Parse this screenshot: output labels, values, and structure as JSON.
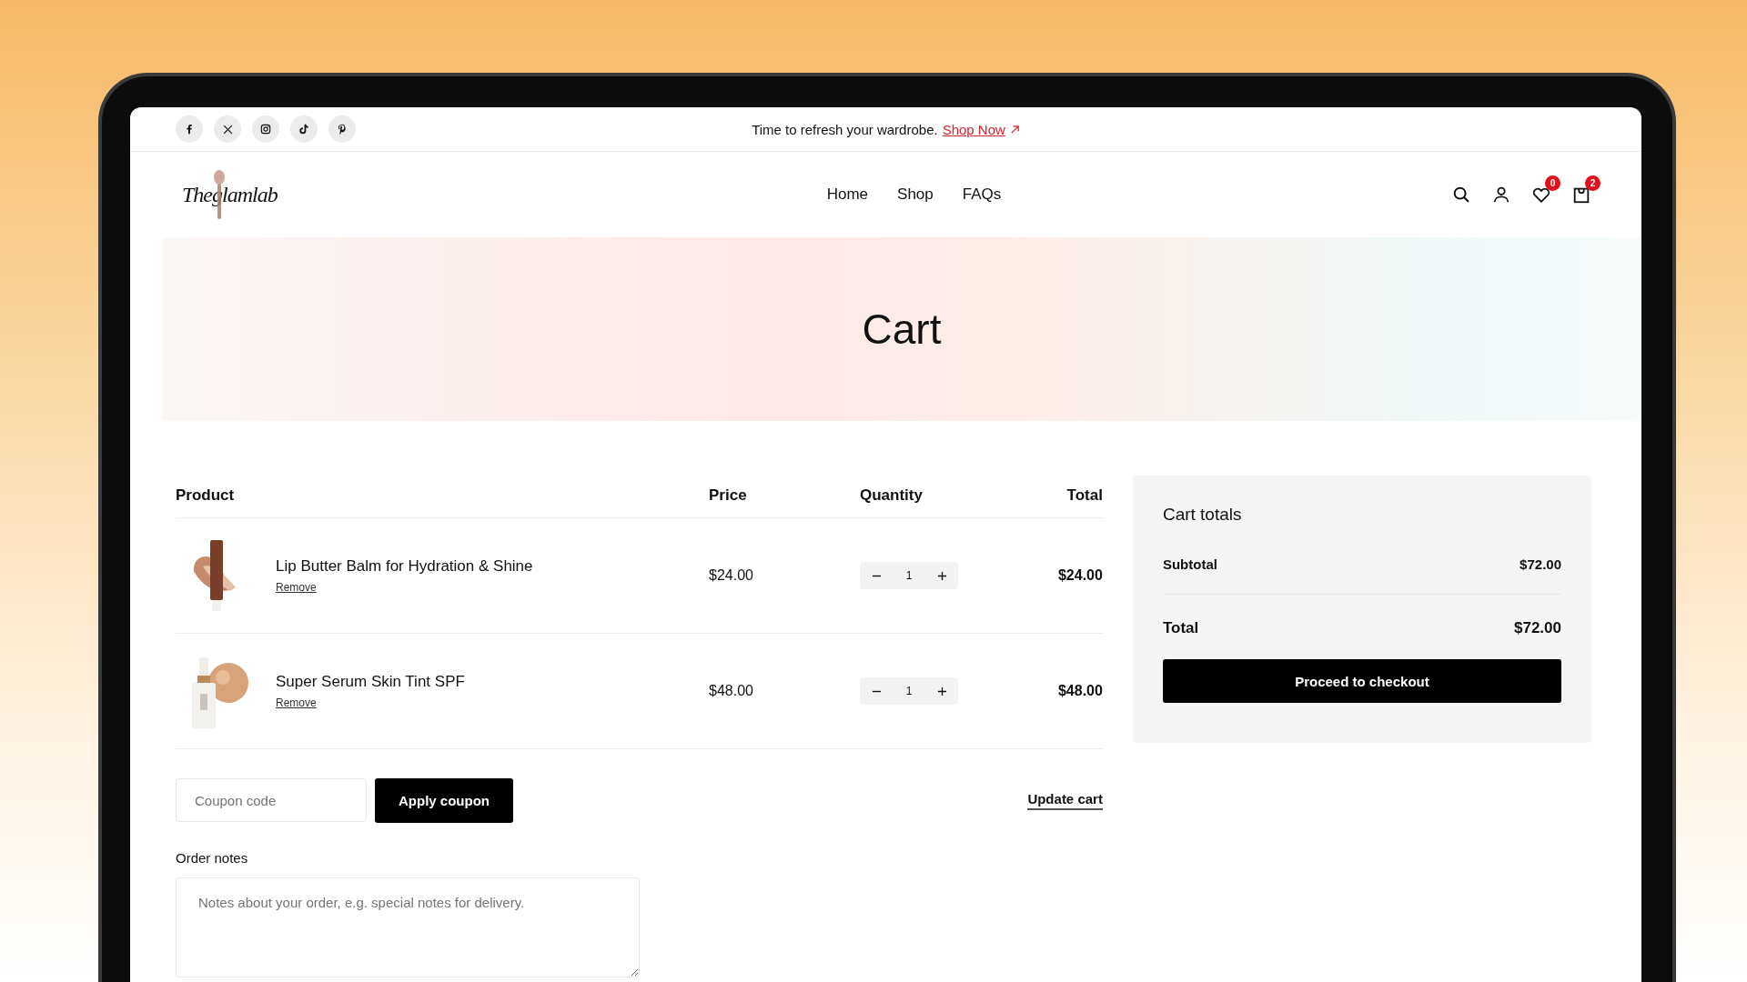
{
  "announcement": {
    "text": "Time to refresh your wardrobe.",
    "link": "Shop Now"
  },
  "logo": {
    "text": "Theglamlab"
  },
  "nav": [
    {
      "label": "Home"
    },
    {
      "label": "Shop"
    },
    {
      "label": "FAQs"
    }
  ],
  "header_icons": {
    "wishlist_count": "0",
    "cart_count": "2"
  },
  "page_title": "Cart",
  "table": {
    "columns": [
      "Product",
      "Price",
      "Quantity",
      "Total"
    ],
    "rows": [
      {
        "name": "Lip Butter Balm for Hydration & Shine",
        "remove": "Remove",
        "price": "$24.00",
        "quantity": "1",
        "total": "$24.00",
        "kind": "tube"
      },
      {
        "name": "Super Serum Skin Tint SPF",
        "remove": "Remove",
        "price": "$48.00",
        "quantity": "1",
        "total": "$48.00",
        "kind": "bottle"
      }
    ]
  },
  "coupon": {
    "placeholder": "Coupon code",
    "button": "Apply coupon"
  },
  "update_cart": "Update cart",
  "order_notes": {
    "label": "Order notes",
    "placeholder": "Notes about your order, e.g. special notes for delivery."
  },
  "cart_totals": {
    "title": "Cart totals",
    "subtotal_label": "Subtotal",
    "subtotal": "$72.00",
    "total_label": "Total",
    "total": "$72.00",
    "checkout": "Proceed to checkout"
  }
}
